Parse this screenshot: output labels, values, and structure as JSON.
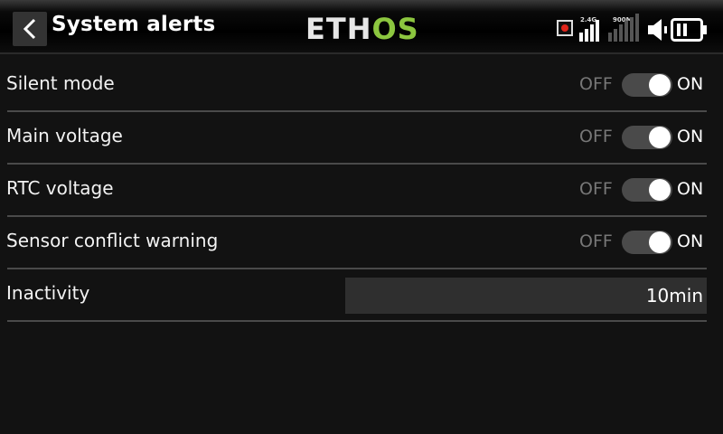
{
  "header": {
    "title": "System alerts",
    "logo_main": "ETH",
    "logo_accent": "OS",
    "signal_24": "2.4G",
    "signal_900": "900M",
    "icons": {
      "back": "chevron-left-icon",
      "record": "record-icon",
      "speaker": "speaker-icon",
      "battery": "battery-icon"
    }
  },
  "rows": [
    {
      "label": "Silent mode",
      "off": "OFF",
      "on": "ON",
      "state": "on"
    },
    {
      "label": "Main voltage",
      "off": "OFF",
      "on": "ON",
      "state": "on"
    },
    {
      "label": "RTC voltage",
      "off": "OFF",
      "on": "ON",
      "state": "on"
    },
    {
      "label": "Sensor conflict warning",
      "off": "OFF",
      "on": "ON",
      "state": "on"
    }
  ],
  "inactivity": {
    "label": "Inactivity",
    "value": "10min"
  },
  "colors": {
    "accent": "#8cc63f",
    "record": "#e0251b",
    "background": "#121212"
  }
}
